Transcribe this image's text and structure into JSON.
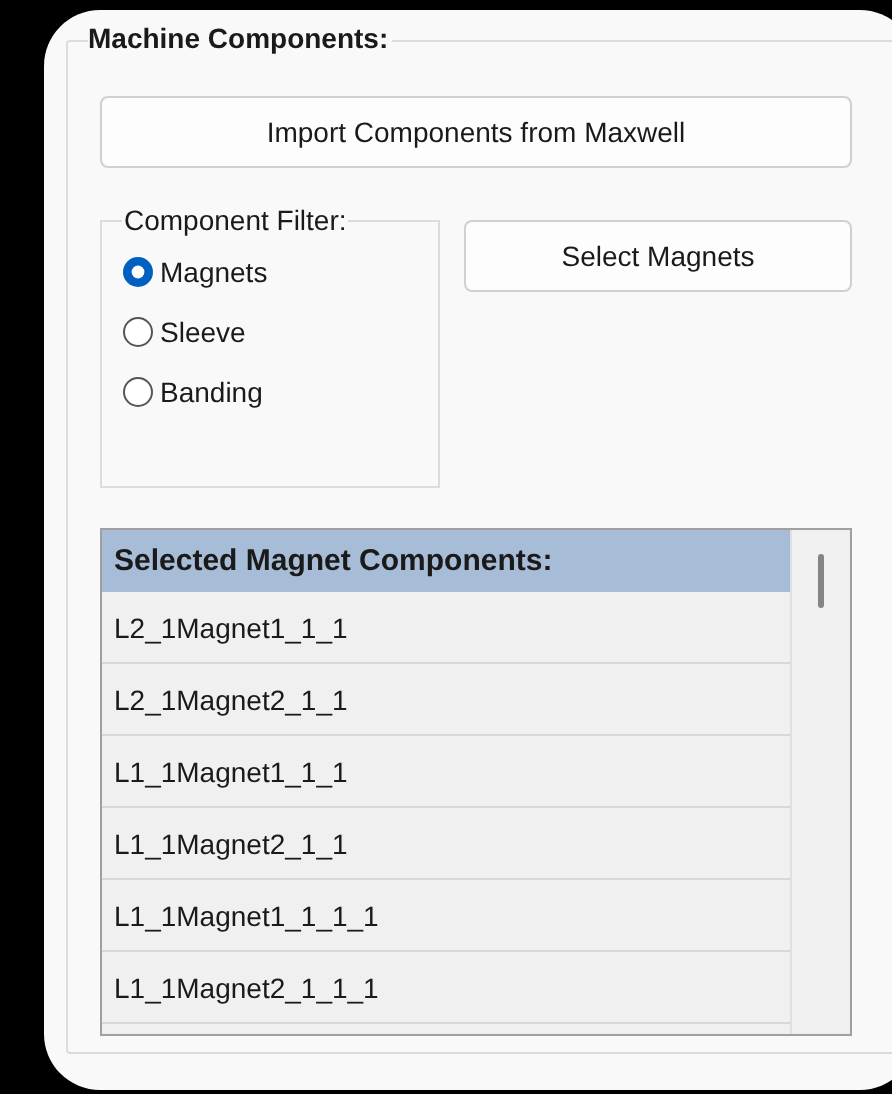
{
  "group": {
    "title": "Machine Components:"
  },
  "import_button": {
    "label": "Import Components from Maxwell"
  },
  "component_filter": {
    "title": "Component Filter:",
    "options": [
      {
        "label": "Magnets",
        "selected": true
      },
      {
        "label": "Sleeve",
        "selected": false
      },
      {
        "label": "Banding",
        "selected": false
      }
    ]
  },
  "select_button": {
    "label": "Select Magnets"
  },
  "grid": {
    "header": "Selected Magnet Components:",
    "rows": [
      "L2_1Magnet1_1_1",
      "L2_1Magnet2_1_1",
      "L1_1Magnet1_1_1",
      "L1_1Magnet2_1_1",
      "L1_1Magnet1_1_1_1",
      "L1_1Magnet2_1_1_1"
    ]
  }
}
